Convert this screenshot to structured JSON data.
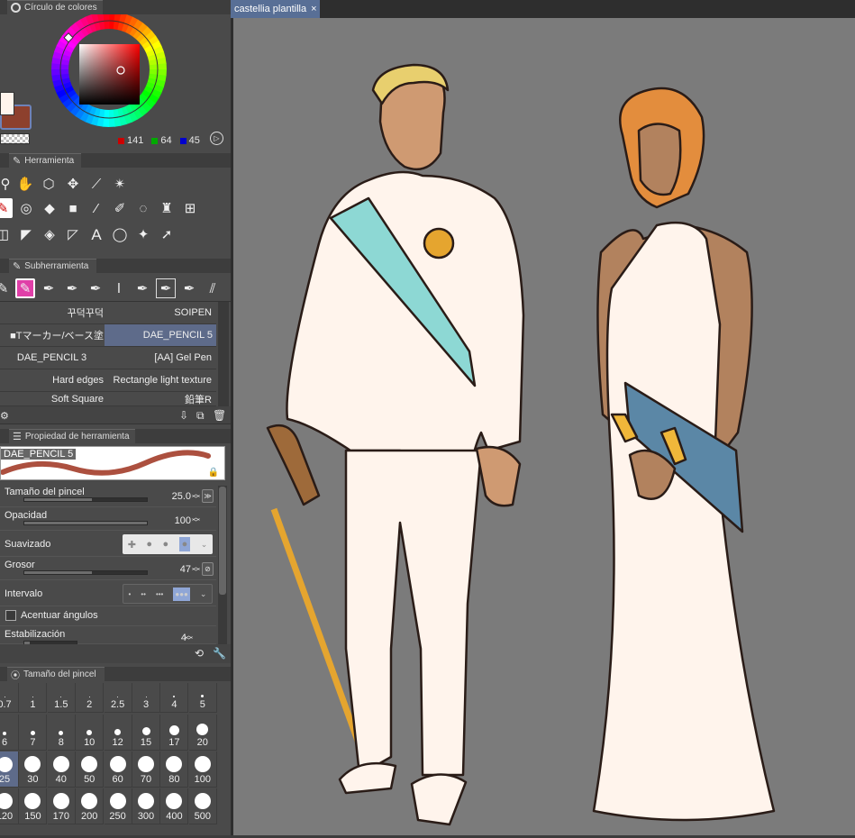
{
  "color_wheel": {
    "title": "Círculo de colores",
    "rgb": {
      "r": "141",
      "g": "64",
      "b": "45"
    },
    "main_color": "#8d402d",
    "sub_color": "#fff4ec"
  },
  "tool_panel": {
    "title": "Herramienta",
    "tools": [
      [
        "zoom-icon",
        "hand-icon",
        "rotate-icon",
        "move-icon",
        "eyedropper-icon",
        "wand-icon"
      ],
      [
        "pen-tool-icon",
        "lasso-fill-icon",
        "eraser-icon",
        "fill-rect-icon",
        "ruler-icon",
        "pencil-icon",
        "lasso-select-icon",
        "stamp-icon",
        "mesh-icon"
      ],
      [
        "frame-icon",
        "gradient-icon",
        "fill-bucket-icon",
        "figure-icon",
        "text-icon",
        "balloon-icon",
        "sparkle-icon",
        "object-select-icon"
      ]
    ]
  },
  "subtool_panel": {
    "title": "Subherramienta",
    "brushes": [
      [
        "꾸덕꾸덕",
        "SOIPEN"
      ],
      [
        "■Tマーカー/ベース塗",
        "DAE_PENCIL 5"
      ],
      [
        "DAE_PENCIL 3",
        "[AA] Gel Pen"
      ],
      [
        "Hard edges",
        "Rectangle light texture"
      ],
      [
        "Soft Square",
        "鉛筆R"
      ]
    ],
    "selected": "DAE_PENCIL 5"
  },
  "tool_property": {
    "title": "Propiedad de herramienta",
    "brush_name": "DAE_PENCIL 5",
    "brush_size_label": "Tamaño del pincel",
    "brush_size": "25.0",
    "opacity_label": "Opacidad",
    "opacity": "100",
    "smoothing_label": "Suavizado",
    "thickness_label": "Grosor",
    "thickness": "47",
    "interval_label": "Intervalo",
    "accent_label": "Acentuar ángulos",
    "stabilization_label": "Estabilización",
    "stabilization": "4"
  },
  "brush_size_panel": {
    "title": "Tamaño del pincel",
    "rows": [
      [
        "0.7",
        "1",
        "1.5",
        "2",
        "2.5",
        "3",
        "4",
        "5"
      ],
      [
        "6",
        "7",
        "8",
        "10",
        "12",
        "15",
        "17",
        "20"
      ],
      [
        "25",
        "30",
        "40",
        "50",
        "60",
        "70",
        "80",
        "100"
      ],
      [
        "120",
        "150",
        "170",
        "200",
        "250",
        "300",
        "400",
        "500"
      ]
    ],
    "selected": "25"
  },
  "canvas": {
    "tab_title": "castellia plantilla",
    "bg_color": "#7b7b7b"
  }
}
